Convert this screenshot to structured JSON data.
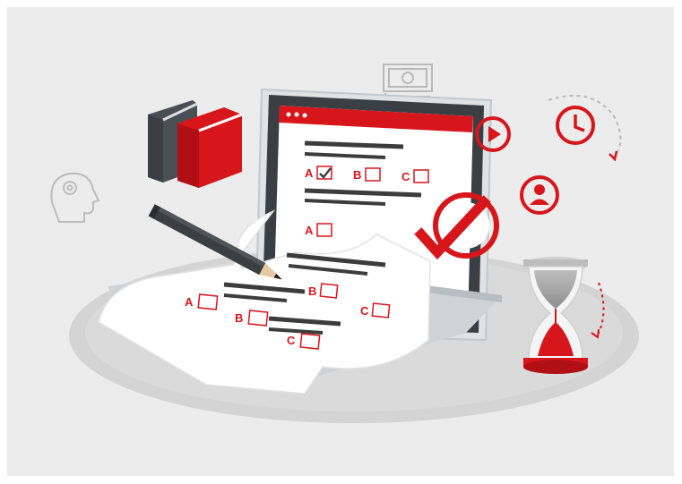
{
  "illustration": {
    "answer_letters": [
      "A",
      "B",
      "C"
    ],
    "colors": {
      "accent": "#d7161c",
      "background": "#ececec",
      "platform": "#d4d4d4",
      "laptop_body": "#cfd3d6",
      "laptop_dark": "#3a3f44",
      "paper": "#ffffff",
      "text_lines": "#3c3c3c",
      "icon_gray": "#b9b9b9"
    },
    "icons": [
      "gear-head-icon",
      "certificate-icon",
      "play-icon",
      "clock-icon",
      "user-icon",
      "hourglass-icon",
      "pencil-icon",
      "books-icon",
      "big-checkmark-icon"
    ]
  }
}
